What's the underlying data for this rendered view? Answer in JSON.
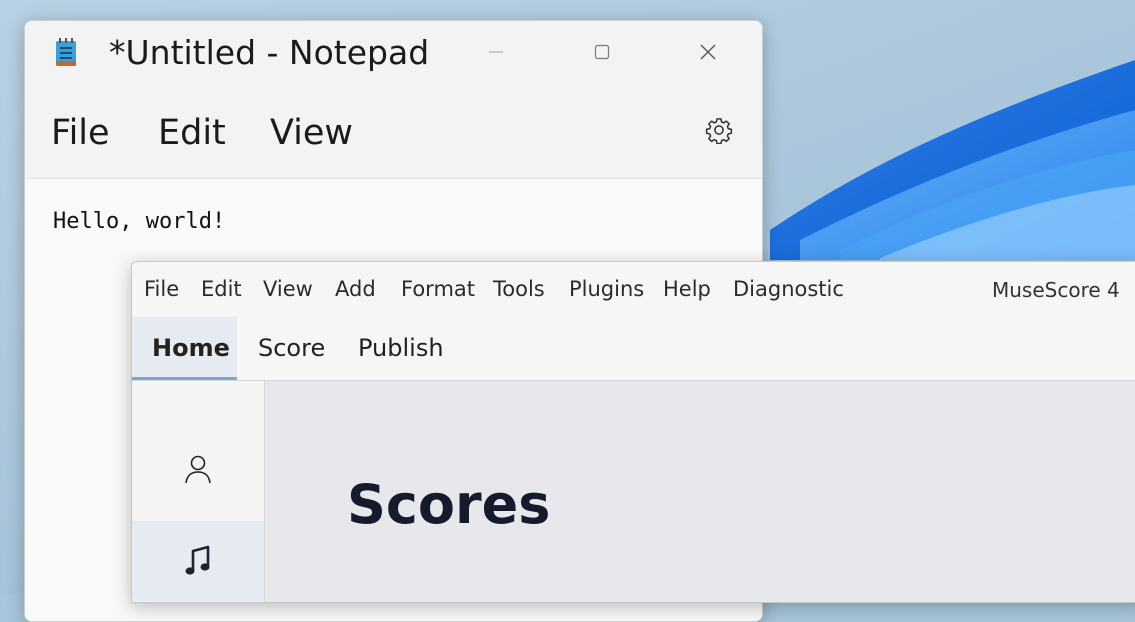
{
  "notepad": {
    "title": "*Untitled - Notepad",
    "menu": [
      "File",
      "Edit",
      "View"
    ],
    "content": "Hello, world!",
    "icons": {
      "app": "notepad-app-icon",
      "minimize": "minimize-icon",
      "maximize": "maximize-icon",
      "close": "close-icon",
      "settings": "gear-icon"
    }
  },
  "musescore": {
    "app_name": "MuseScore 4",
    "menu": [
      "File",
      "Edit",
      "View",
      "Add",
      "Format",
      "Tools",
      "Plugins",
      "Help",
      "Diagnostic"
    ],
    "tabs": [
      {
        "label": "Home",
        "active": true
      },
      {
        "label": "Score",
        "active": false
      },
      {
        "label": "Publish",
        "active": false
      }
    ],
    "sidebar": [
      {
        "icon": "account-icon",
        "selected": false
      },
      {
        "icon": "music-note-icon",
        "selected": true
      }
    ],
    "page_heading": "Scores",
    "colors": {
      "accent": "#7fa6cf",
      "selected_bg": "#e6ebf1"
    }
  },
  "desktop": {
    "wallpaper": "windows-11-bloom"
  }
}
